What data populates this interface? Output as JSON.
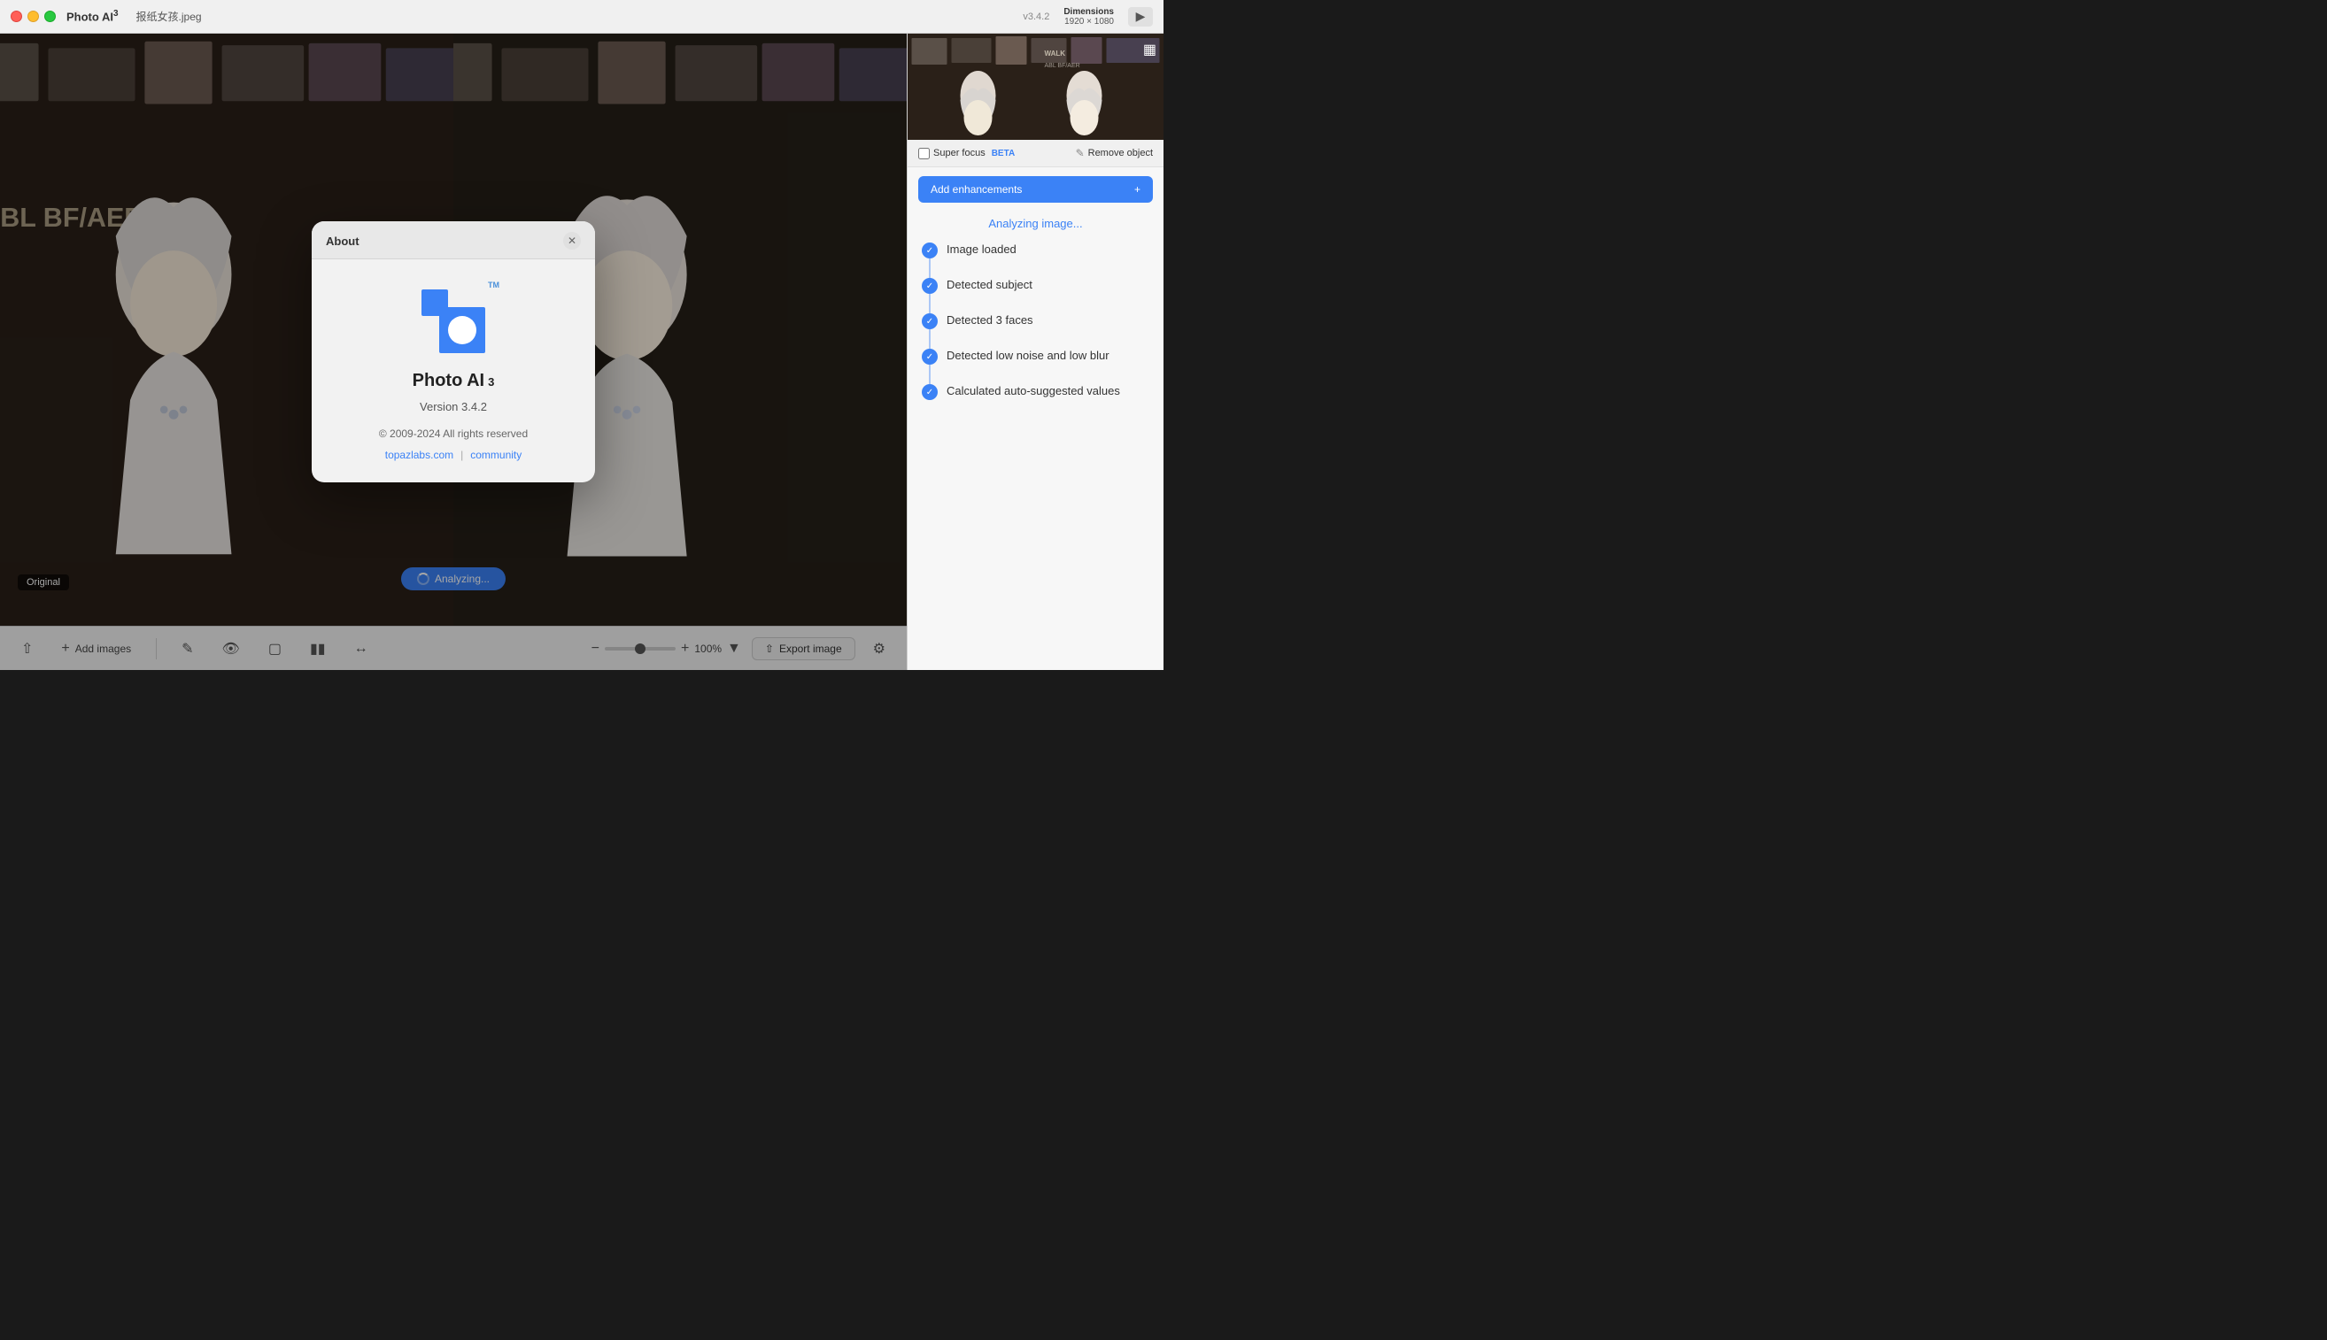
{
  "titlebar": {
    "app_name": "Photo AI",
    "app_superscript": "3",
    "file_name": "报纸女孩.jpeg",
    "version": "v3.4.2",
    "dimensions_label": "Dimensions",
    "dimensions_value": "1920 × 1080"
  },
  "about_dialog": {
    "title": "About",
    "app_name": "Photo AI",
    "app_superscript": "3",
    "tm": "TM",
    "version": "Version 3.4.2",
    "copyright": "© 2009-2024 All rights reserved",
    "link_website": "topazlabs.com",
    "link_separator": "|",
    "link_community": "community"
  },
  "sidebar": {
    "super_focus_label": "Super focus",
    "super_focus_badge": "BETA",
    "remove_object_label": "Remove object",
    "add_enhancements_label": "Add enhancements",
    "add_enhancements_icon": "+",
    "analyzing_label": "Analyzing image...",
    "steps": [
      {
        "label": "Image loaded",
        "done": true
      },
      {
        "label": "Detected subject",
        "done": true
      },
      {
        "label": "Detected 3 faces",
        "done": true
      },
      {
        "label": "Detected low noise and low blur",
        "done": true
      },
      {
        "label": "Calculated auto-suggested values",
        "done": true
      }
    ]
  },
  "bottom_toolbar": {
    "add_images_label": "Add images",
    "zoom_value": "100%",
    "export_label": "Export image"
  },
  "canvas": {
    "original_label": "Original",
    "analyzing_label": "Analyzing..."
  }
}
